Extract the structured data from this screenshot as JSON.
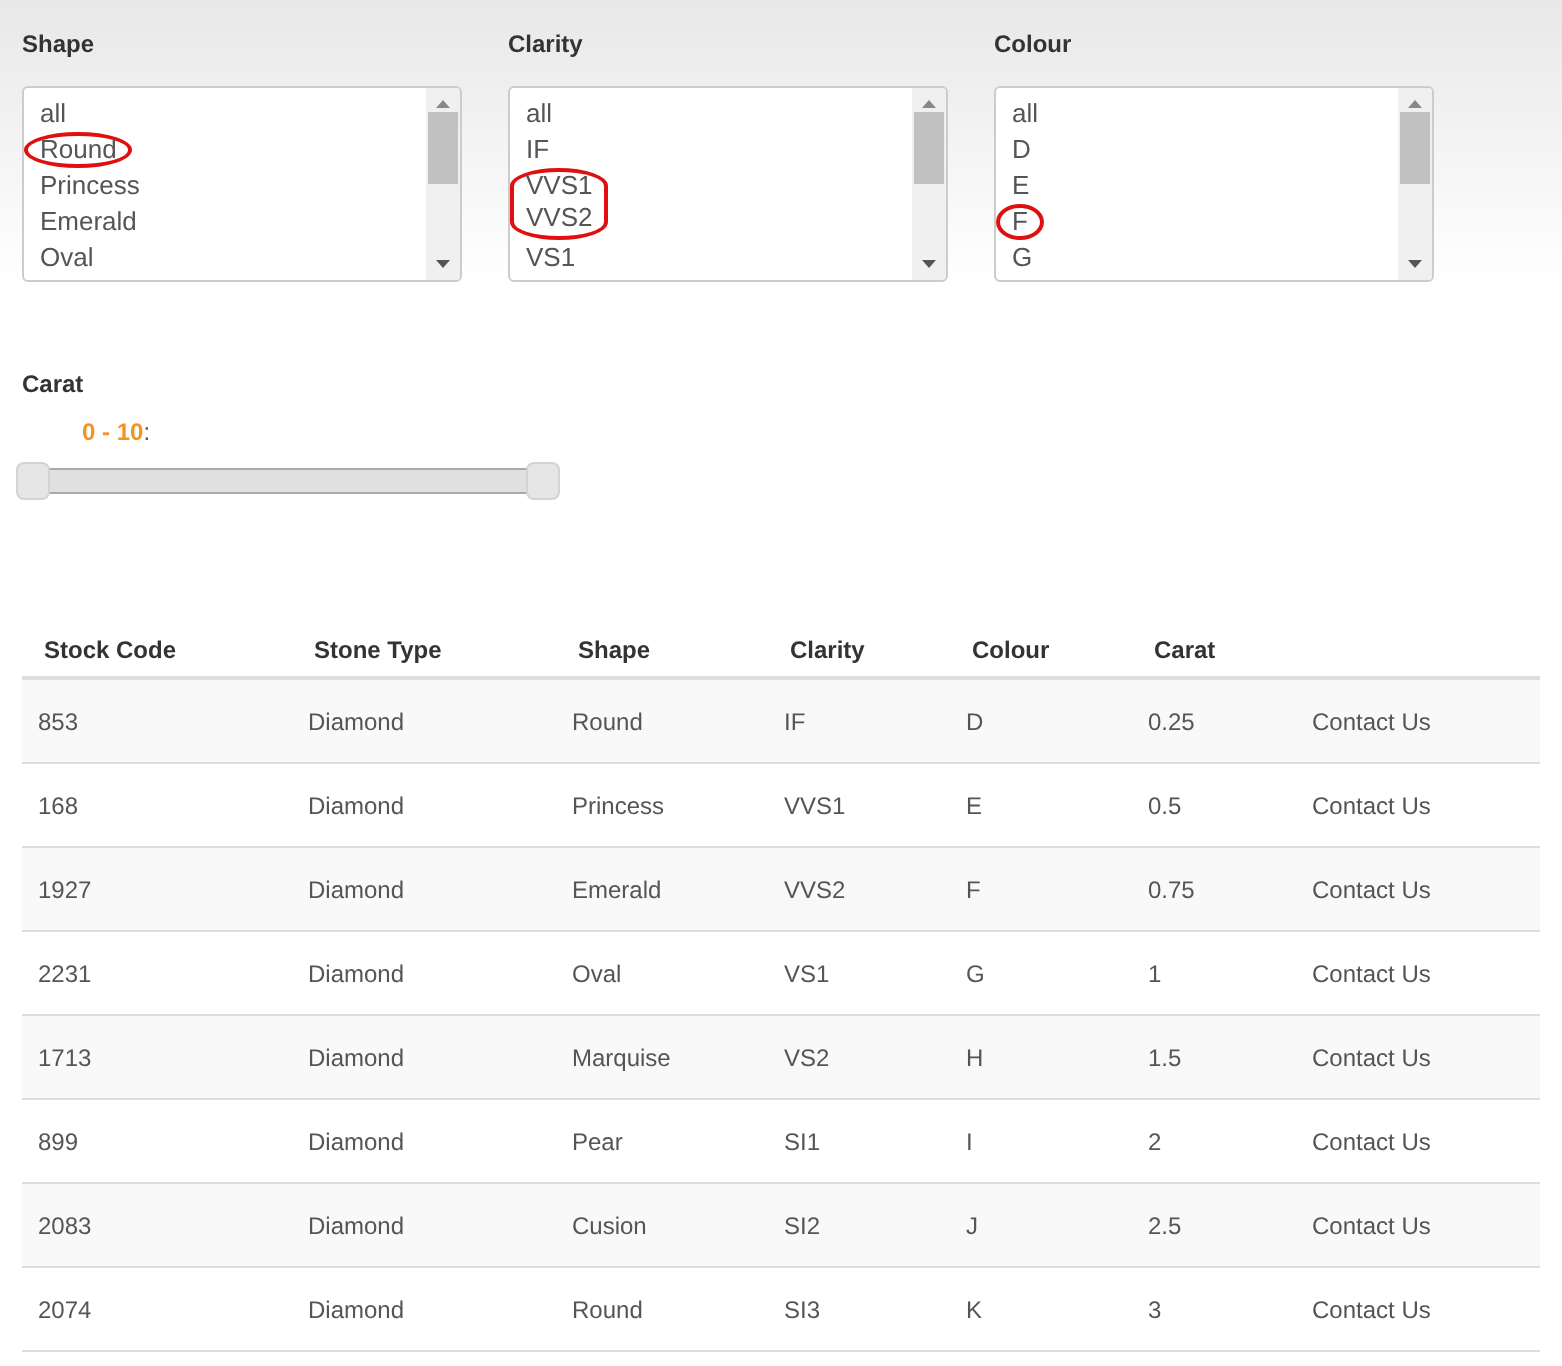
{
  "filters": [
    {
      "label": "Shape",
      "items": [
        {
          "text": "all",
          "circled": false
        },
        {
          "text": "Round",
          "circled": true
        },
        {
          "text": "Princess",
          "circled": false
        },
        {
          "text": "Emerald",
          "circled": false
        },
        {
          "text": "Oval",
          "circled": false
        }
      ]
    },
    {
      "label": "Clarity",
      "items": [
        {
          "text": "all",
          "circled": false
        },
        {
          "text": "IF",
          "circled": false
        },
        {
          "text": "VVS1",
          "circled": true
        },
        {
          "text": "VVS2",
          "circled": true
        },
        {
          "text": "VS1",
          "circled": false
        }
      ]
    },
    {
      "label": "Colour",
      "items": [
        {
          "text": "all",
          "circled": false
        },
        {
          "text": "D",
          "circled": false
        },
        {
          "text": "E",
          "circled": false
        },
        {
          "text": "F",
          "circled": true
        },
        {
          "text": "G",
          "circled": false
        }
      ]
    }
  ],
  "carat": {
    "label": "Carat",
    "range": "0 - 10",
    "suffix": ":",
    "handles": [
      {
        "level": 0
      },
      {
        "level": 1
      }
    ]
  },
  "table": {
    "columns": [
      "Stock Code",
      "Stone Type",
      "Shape",
      "Clarity",
      "Colour",
      "Carat",
      ""
    ],
    "rows": [
      [
        "853",
        "Diamond",
        "Round",
        "IF",
        "D",
        "0.25",
        "Contact Us"
      ],
      [
        "168",
        "Diamond",
        "Princess",
        "VVS1",
        "E",
        "0.5",
        "Contact Us"
      ],
      [
        "1927",
        "Diamond",
        "Emerald",
        "VVS2",
        "F",
        "0.75",
        "Contact Us"
      ],
      [
        "2231",
        "Diamond",
        "Oval",
        "VS1",
        "G",
        "1",
        "Contact Us"
      ],
      [
        "1713",
        "Diamond",
        "Marquise",
        "VS2",
        "H",
        "1.5",
        "Contact Us"
      ],
      [
        "899",
        "Diamond",
        "Pear",
        "SI1",
        "I",
        "2",
        "Contact Us"
      ],
      [
        "2083",
        "Diamond",
        "Cusion",
        "SI2",
        "J",
        "2.5",
        "Contact Us"
      ],
      [
        "2074",
        "Diamond",
        "Round",
        "SI3",
        "K",
        "3",
        "Contact Us"
      ]
    ]
  }
}
